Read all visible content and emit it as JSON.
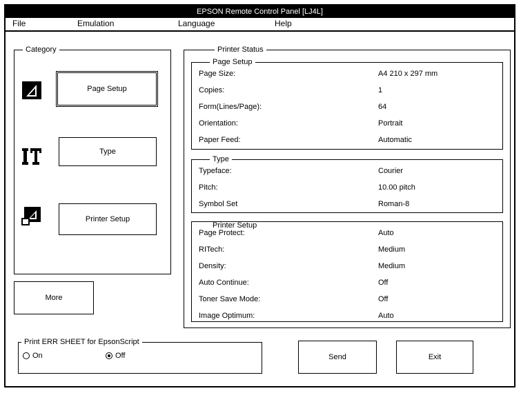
{
  "window": {
    "title": "EPSON Remote Control Panel  [LJ4L]"
  },
  "menubar": {
    "items": [
      {
        "label": "File"
      },
      {
        "label": "Emulation"
      },
      {
        "label": "Language"
      },
      {
        "label": "Help"
      }
    ]
  },
  "category": {
    "title": "Category",
    "buttons": [
      {
        "label": "Page Setup",
        "icon": "page-setup-icon"
      },
      {
        "label": "Type",
        "icon": "typeface-icon"
      },
      {
        "label": "Printer Setup",
        "icon": "printer-setup-icon"
      }
    ]
  },
  "more_button": {
    "label": "More"
  },
  "printer_status": {
    "title": "Printer Status",
    "sections": [
      {
        "title": "Page Setup",
        "rows": [
          {
            "key": "Page Size:",
            "value": "A4 210 x 297 mm"
          },
          {
            "key": "Copies:",
            "value": "1"
          },
          {
            "key": "Form(Lines/Page):",
            "value": "64"
          },
          {
            "key": "Orientation:",
            "value": "Portrait"
          },
          {
            "key": "Paper Feed:",
            "value": "Automatic"
          }
        ]
      },
      {
        "title": "Type",
        "rows": [
          {
            "key": "Typeface:",
            "value": "Courier"
          },
          {
            "key": "Pitch:",
            "value": "10.00 pitch"
          },
          {
            "key": "Symbol Set",
            "value": "Roman-8"
          }
        ]
      },
      {
        "title": "Printer Setup",
        "rows": [
          {
            "key": "Page Protect:",
            "value": "Auto"
          },
          {
            "key": "RITech:",
            "value": "Medium"
          },
          {
            "key": "Density:",
            "value": "Medium"
          },
          {
            "key": "Auto Continue:",
            "value": "Off"
          },
          {
            "key": "Toner Save Mode:",
            "value": "Off"
          },
          {
            "key": "Image Optimum:",
            "value": "Auto"
          }
        ]
      }
    ]
  },
  "err_sheet": {
    "title": "Print ERR SHEET for EpsonScript",
    "options": [
      {
        "label": "On",
        "checked": false
      },
      {
        "label": "Off",
        "checked": true
      }
    ]
  },
  "actions": {
    "send_label": "Send",
    "exit_label": "Exit"
  }
}
